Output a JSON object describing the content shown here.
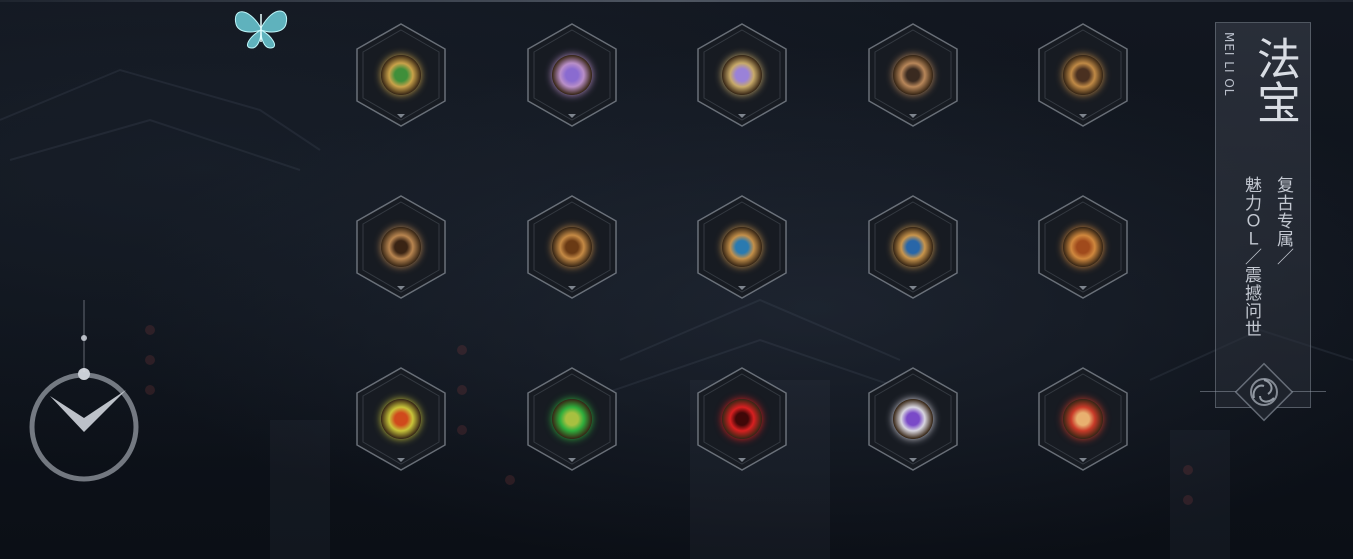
{
  "side_panel": {
    "pinyin": "MEI LI OL",
    "title": "法宝",
    "tagline_col1": "复古专属／",
    "tagline_col2": "魅力ＯＬ／震撼问世"
  },
  "relics": [
    {
      "name": "relic-1",
      "color": "#c9a24a",
      "accent": "#3f8f3a"
    },
    {
      "name": "relic-2",
      "color": "#b98fc8",
      "accent": "#8a6bd0"
    },
    {
      "name": "relic-3",
      "color": "#c8aa6a",
      "accent": "#9a82d8"
    },
    {
      "name": "relic-4",
      "color": "#b8875a",
      "accent": "#3a2a20"
    },
    {
      "name": "relic-5",
      "color": "#c08a46",
      "accent": "#4a3020"
    },
    {
      "name": "relic-6",
      "color": "#b88550",
      "accent": "#3a2414"
    },
    {
      "name": "relic-7",
      "color": "#c58a45",
      "accent": "#6a3a14"
    },
    {
      "name": "relic-8",
      "color": "#c4904a",
      "accent": "#2a7ab0"
    },
    {
      "name": "relic-9",
      "color": "#c9954c",
      "accent": "#2866a8"
    },
    {
      "name": "relic-10",
      "color": "#d0883e",
      "accent": "#a04a1c"
    },
    {
      "name": "relic-11",
      "color": "#c8c43a",
      "accent": "#d04a1c"
    },
    {
      "name": "relic-12",
      "color": "#2fae3c",
      "accent": "#a8c040"
    },
    {
      "name": "relic-13",
      "color": "#d82020",
      "accent": "#400808"
    },
    {
      "name": "relic-14",
      "color": "#d8d6e0",
      "accent": "#7a4ac8"
    },
    {
      "name": "relic-15",
      "color": "#c83a28",
      "accent": "#e8b070"
    }
  ]
}
